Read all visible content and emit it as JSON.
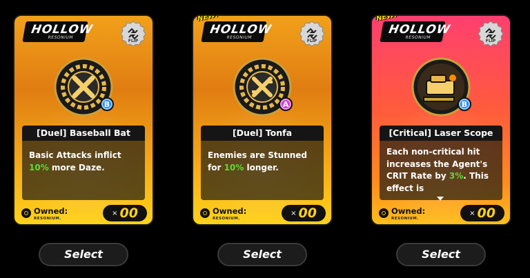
{
  "cards": [
    {
      "logo": "HOLLOW",
      "logo_sub": "RESONIUM",
      "new_tag": "",
      "flip_label": "FLIP",
      "rank": "B",
      "name": "[Duel] Baseball Bat",
      "desc_before": "Basic Attacks inflict ",
      "desc_highlight": "10%",
      "desc_after": " more Daze.",
      "owned_label": "Owned:",
      "owned_sub": "RESONIUM.",
      "count_x": "×",
      "count": "00",
      "select": "Select"
    },
    {
      "logo": "HOLLOW",
      "logo_sub": "RESONIUM",
      "new_tag": "NEW!",
      "flip_label": "FLIP",
      "rank": "A",
      "name": "[Duel] Tonfa",
      "desc_before": "Enemies are Stunned for ",
      "desc_highlight": "10%",
      "desc_after": " longer.",
      "owned_label": "Owned:",
      "owned_sub": "RESONIUM.",
      "count_x": "×",
      "count": "00",
      "select": "Select"
    },
    {
      "logo": "HOLLOW",
      "logo_sub": "RESONIUM",
      "new_tag": "NEW!",
      "flip_label": "FLIP",
      "rank": "B",
      "name": "[Critical] Laser Scope",
      "desc_before": "Each non-critical hit increases the Agent's CRIT Rate by ",
      "desc_highlight": "3%",
      "desc_after": ". This effect is",
      "owned_label": "Owned:",
      "owned_sub": "RESONIUM.",
      "count_x": "×",
      "count": "00",
      "select": "Select"
    }
  ],
  "colors": {
    "gold": "#f2a11a",
    "pink": "#ff3f6f",
    "highlight": "#5cdc3a",
    "rank_b": "#1f8bff",
    "rank_a": "#d33cd6"
  }
}
